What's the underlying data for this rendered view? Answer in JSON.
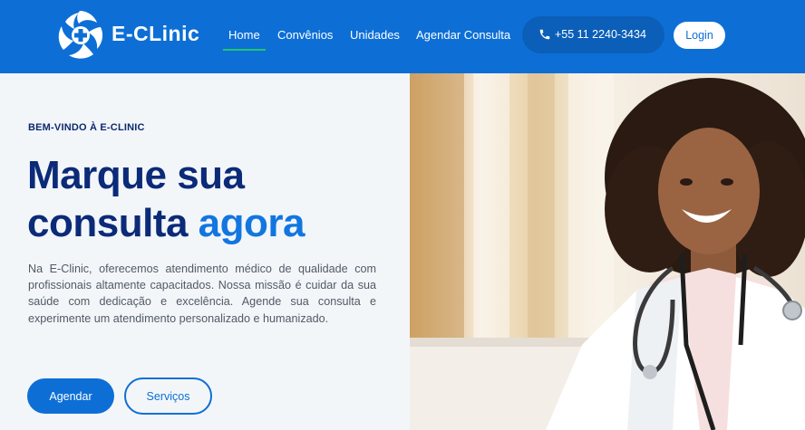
{
  "brand": {
    "name": "E-CLinic"
  },
  "nav": {
    "items": [
      {
        "label": "Home",
        "active": true
      },
      {
        "label": "Convênios",
        "active": false
      },
      {
        "label": "Unidades",
        "active": false
      },
      {
        "label": "Agendar Consulta",
        "active": false
      }
    ]
  },
  "contact": {
    "phone": "+55 11 2240-3434",
    "icon": "phone-icon"
  },
  "auth": {
    "login_label": "Login"
  },
  "hero": {
    "kicker": "BEM-VINDO À E-CLINIC",
    "headline_line1": "Marque sua",
    "headline_line2": "consulta",
    "headline_accent": "agora",
    "paragraph": "Na E-Clinic, oferecemos atendimento médico de qualidade com profissionais altamente capacitados. Nossa missão é cuidar da sua saúde com dedicação e excelência. Agende sua consulta e experimente um atendimento personalizado e humanizado.",
    "primary_button": "Agendar",
    "secondary_button": "Serviços"
  },
  "colors": {
    "header_bg": "#0d6fd6",
    "accent": "#1276e0",
    "headline": "#0b2a78",
    "active_underline": "#1fc76a",
    "phone_pill": "#0b5fb8"
  }
}
